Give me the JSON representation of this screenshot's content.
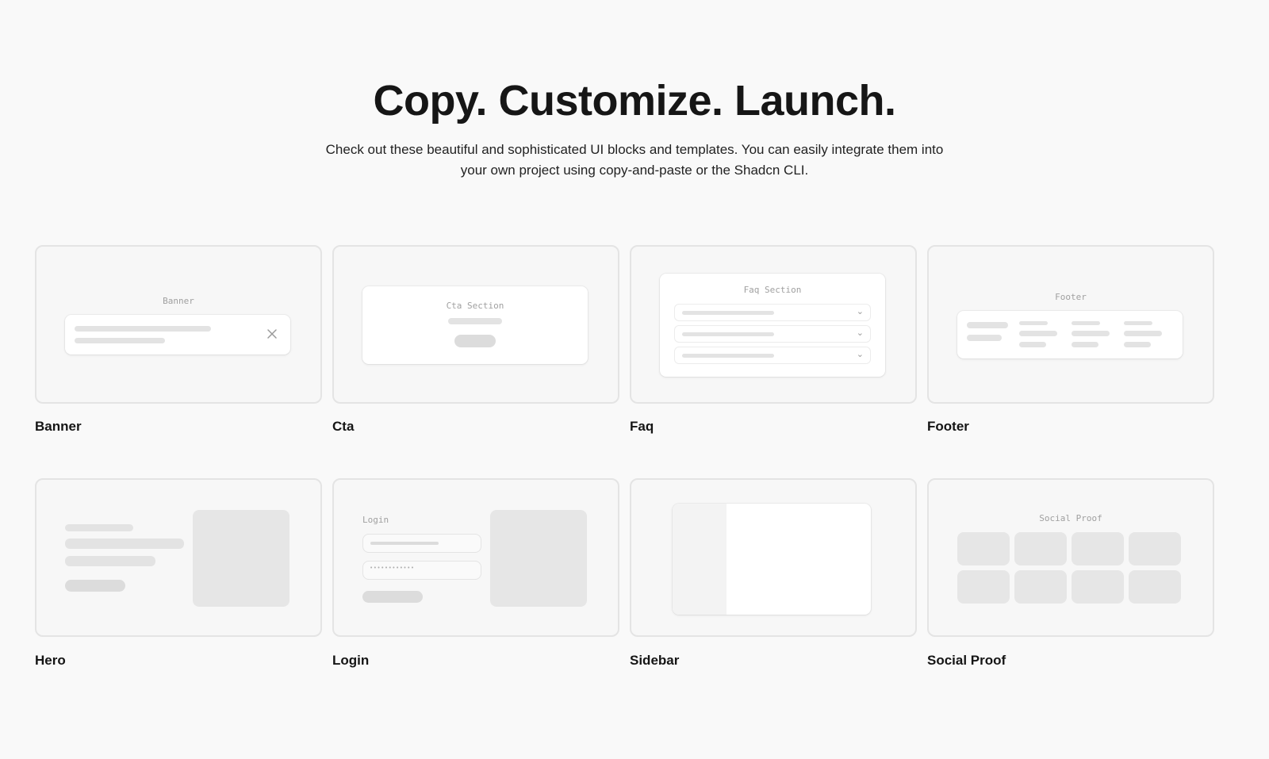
{
  "header": {
    "title": "Copy. Customize. Launch.",
    "subtitle": "Check out these beautiful and sophisticated UI blocks and templates. You can easily integrate them into your own project using copy-and-paste or the Shadcn CLI."
  },
  "cards": {
    "banner": {
      "label": "Banner",
      "preview_caption": "Banner"
    },
    "cta": {
      "label": "Cta",
      "preview_caption": "Cta Section"
    },
    "faq": {
      "label": "Faq",
      "preview_caption": "Faq Section"
    },
    "footer": {
      "label": "Footer",
      "preview_caption": "Footer"
    },
    "hero": {
      "label": "Hero"
    },
    "login": {
      "label": "Login",
      "preview_caption": "Login",
      "password_mask": "••••••••••••"
    },
    "sidebar": {
      "label": "Sidebar"
    },
    "social_proof": {
      "label": "Social Proof",
      "preview_caption": "Social Proof"
    }
  },
  "icons": {
    "close": "close-icon",
    "chevron": "chevron-down-icon"
  },
  "colors": {
    "background": "#f9f9f9",
    "card_border": "#e4e4e4",
    "skeleton": "#e3e3e3",
    "text": "#151515"
  }
}
